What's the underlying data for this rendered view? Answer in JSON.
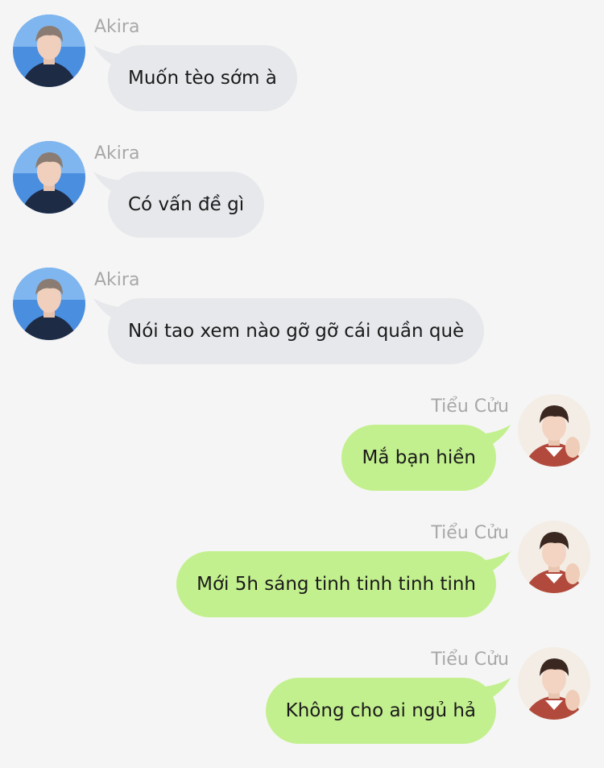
{
  "messages": [
    {
      "sender": "Akira",
      "side": "left",
      "text": "Muốn tèo sớm à"
    },
    {
      "sender": "Akira",
      "side": "left",
      "text": "Có vấn đề gì"
    },
    {
      "sender": "Akira",
      "side": "left",
      "text": "Nói tao xem nào gỡ gỡ cái quần què"
    },
    {
      "sender": "Tiểu Cửu",
      "side": "right",
      "text": "Mắ bạn hiền"
    },
    {
      "sender": "Tiểu Cửu",
      "side": "right",
      "text": "Mới 5h sáng tinh tinh tinh tinh"
    },
    {
      "sender": "Tiểu Cửu",
      "side": "right",
      "text": "Không cho ai ngủ hả"
    }
  ],
  "colors": {
    "background": "#f5f5f5",
    "left_bubble": "#e6e8eb",
    "right_bubble": "#c3f08e",
    "name_text": "#a8a8a8"
  }
}
